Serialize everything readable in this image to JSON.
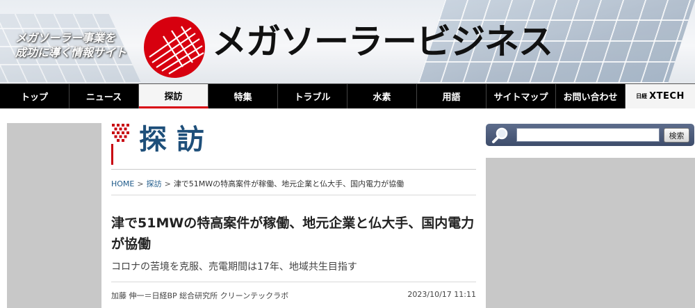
{
  "header": {
    "tagline_line1": "メガソーラー事業を",
    "tagline_line2": "成功に導く情報サイト",
    "logo_text": "メガソーラービジネス"
  },
  "nav": {
    "items": [
      {
        "label": "トップ"
      },
      {
        "label": "ニュース"
      },
      {
        "label": "探訪",
        "active": true
      },
      {
        "label": "特集"
      },
      {
        "label": "トラブル"
      },
      {
        "label": "水素"
      },
      {
        "label": "用語"
      },
      {
        "label": "サイトマップ"
      },
      {
        "label": "お問い合わせ"
      }
    ],
    "xtech_small": "日経",
    "xtech_big": "XTECH"
  },
  "section": {
    "title": "探訪"
  },
  "breadcrumb": {
    "home": "HOME",
    "section": "探訪",
    "current": "津で51MWの特高案件が稼働、地元企業と仏大手、国内電力が協働",
    "separator": ">"
  },
  "article": {
    "headline": "津で51MWの特高案件が稼働、地元企業と仏大手、国内電力が協働",
    "subhead": "コロナの苦境を克服、売電期間は17年、地域共生目指す",
    "author": "加藤 伸一＝日経BP 総合研究所 クリーンテックラボ",
    "date": "2023/10/17 11:11"
  },
  "search": {
    "placeholder": "",
    "button_label": "検索"
  },
  "colors": {
    "accent_red": "#d7000f",
    "section_blue": "#1e4f7a",
    "nav_bg": "#000000"
  }
}
